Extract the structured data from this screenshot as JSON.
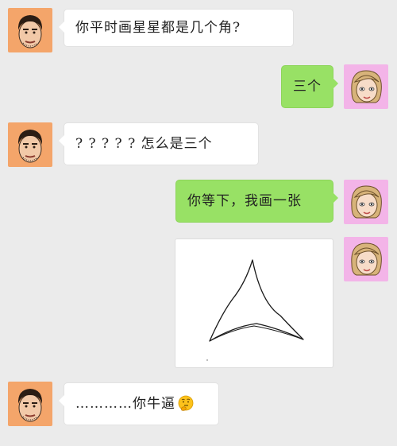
{
  "messages": [
    {
      "side": "left",
      "text": "你平时画星星都是几个角?"
    },
    {
      "side": "right",
      "text": "三个"
    },
    {
      "side": "left",
      "text": "? ? ? ? ? 怎么是三个"
    },
    {
      "side": "right",
      "text": "你等下，我画一张"
    },
    {
      "side": "right",
      "type": "image",
      "content": "hand-drawn three-pointed star"
    },
    {
      "side": "left",
      "text": "…………你牛逼",
      "emoji": "thinking-face"
    }
  ],
  "colors": {
    "background": "#ebebeb",
    "outgoing_bubble": "#98e165",
    "incoming_bubble": "#ffffff",
    "left_avatar_bg": "#f4a56a",
    "right_avatar_bg": "#f3b4e8"
  },
  "icons": {
    "left_avatar": "cartoon-man-avatar",
    "right_avatar": "cartoon-woman-avatar"
  }
}
